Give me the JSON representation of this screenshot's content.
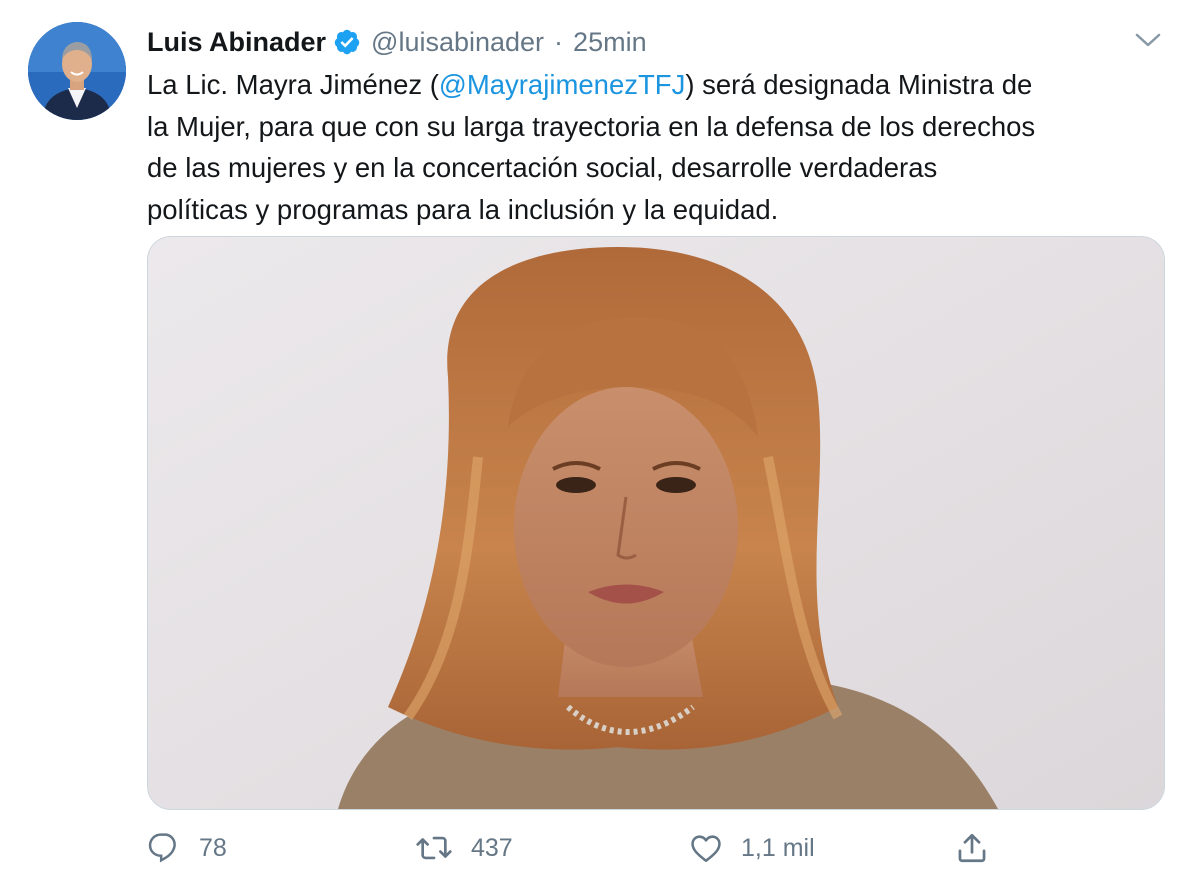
{
  "tweet": {
    "author": {
      "name": "Luis Abinader",
      "handle": "@luisabinader",
      "verified": true,
      "avatar_icon": "profile-photo"
    },
    "separator": "·",
    "time": "25min",
    "text": {
      "line1_before": "La Lic. Mayra Jiménez (",
      "mention": "@MayrajimenezTFJ",
      "line1_after": ") será designada Ministra de",
      "line2": "la Mujer, para que con su larga trayectoria en la defensa de los derechos",
      "line3": "de las mujeres y en la concertación social, desarrolle verdaderas",
      "line4": "políticas y programas para la inclusión y la equidad."
    },
    "media": {
      "kind": "photo"
    },
    "actions": {
      "reply_count": "78",
      "retweet_count": "437",
      "like_count": "1,1 mil"
    },
    "colors": {
      "accent": "#1b95e0",
      "verified": "#1da1f2",
      "secondary_text": "#657786",
      "primary_text": "#14171a",
      "border": "#ccd6dd"
    }
  }
}
